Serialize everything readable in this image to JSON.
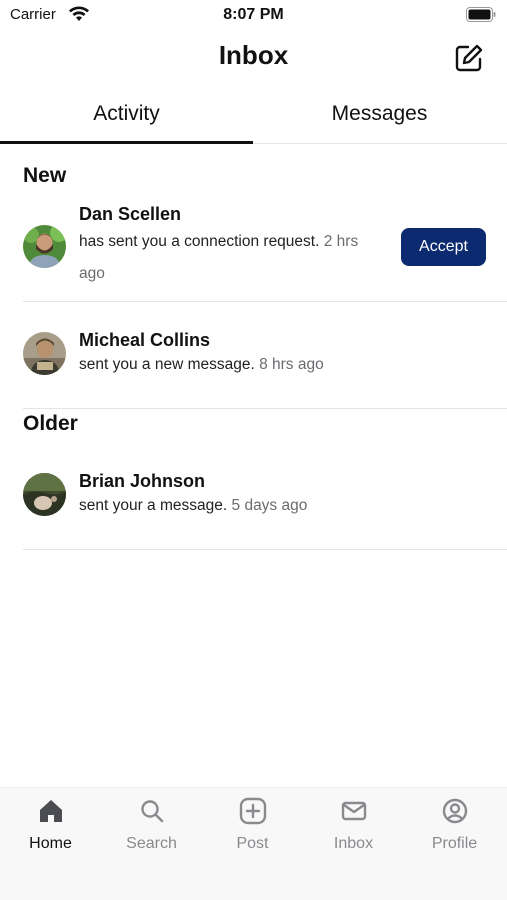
{
  "status_bar": {
    "carrier": "Carrier",
    "time": "8:07 PM"
  },
  "nav": {
    "title": "Inbox"
  },
  "tabs": [
    {
      "label": "Activity",
      "active": true
    },
    {
      "label": "Messages",
      "active": false
    }
  ],
  "sections": {
    "new_title": "New",
    "older_title": "Older"
  },
  "activity": [
    {
      "name": "Dan Scellen",
      "text": "has sent you a connection request.",
      "time": "2 hrs ago",
      "action": "Accept"
    },
    {
      "name": "Micheal Collins",
      "text": "sent you a new message.",
      "time": "8 hrs ago"
    },
    {
      "name": "Brian Johnson",
      "text": "sent your a message.",
      "time": "5 days ago"
    }
  ],
  "tab_bar": [
    {
      "label": "Home",
      "icon": "home-icon",
      "active": true
    },
    {
      "label": "Search",
      "icon": "search-icon",
      "active": false
    },
    {
      "label": "Post",
      "icon": "plus-square-icon",
      "active": false
    },
    {
      "label": "Inbox",
      "icon": "mail-icon",
      "active": false
    },
    {
      "label": "Profile",
      "icon": "user-circle-icon",
      "active": false
    }
  ],
  "colors": {
    "accent": "#0b2a6f",
    "muted": "#8a8a8e",
    "divider": "#e4e4e6"
  }
}
